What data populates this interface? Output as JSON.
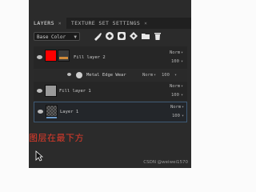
{
  "tabs": [
    {
      "label": "LAYERS",
      "close": "×"
    },
    {
      "label": "TEXTURE SET SETTINGS",
      "close": "×"
    }
  ],
  "channel_select": {
    "value": "Base Color"
  },
  "toolbar_icons": [
    "paint-icon",
    "fill-icon",
    "mask-icon",
    "effect-icon",
    "folder-icon",
    "delete-icon"
  ],
  "layers": [
    {
      "name": "Fill layer 2",
      "blend": "Norm",
      "opacity": "100",
      "thumb_color": "#ff0000"
    },
    {
      "name": "Metal Edge Wear",
      "blend": "Norm",
      "opacity": "100"
    },
    {
      "name": "Fill layer 1",
      "blend": "Norm",
      "opacity": "100",
      "thumb_color": "#9a9a9a"
    },
    {
      "name": "Layer 1",
      "blend": "Norm",
      "opacity": "100"
    }
  ],
  "caption": "图层在最下方",
  "watermark": "CSDN @weiwei1570"
}
